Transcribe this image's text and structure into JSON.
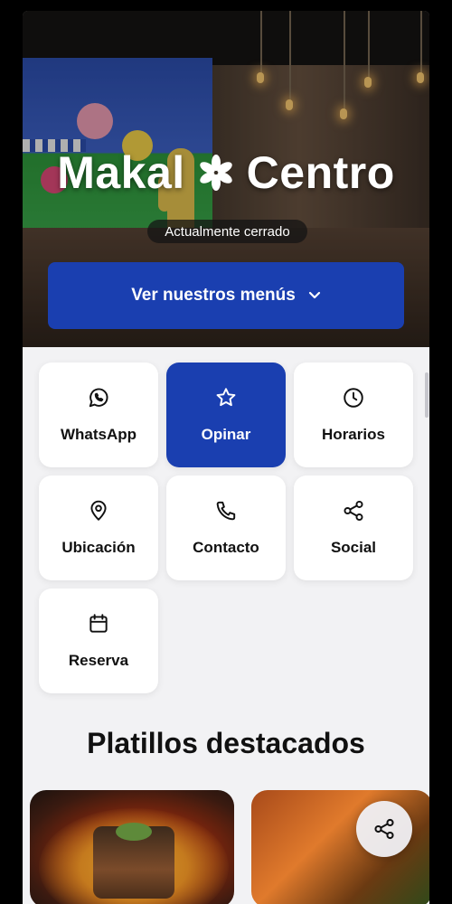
{
  "hero": {
    "venue_name_left": "Makal",
    "venue_name_right": "Centro",
    "status": "Actualmente cerrado",
    "menu_button_label": "Ver nuestros menús"
  },
  "actions": [
    {
      "label": "WhatsApp",
      "icon": "whatsapp-icon",
      "active": false
    },
    {
      "label": "Opinar",
      "icon": "star-icon",
      "active": true
    },
    {
      "label": "Horarios",
      "icon": "clock-icon",
      "active": false
    },
    {
      "label": "Ubicación",
      "icon": "location-pin-icon",
      "active": false
    },
    {
      "label": "Contacto",
      "icon": "phone-icon",
      "active": false
    },
    {
      "label": "Social",
      "icon": "share-icon",
      "active": false
    },
    {
      "label": "Reserva",
      "icon": "calendar-icon",
      "active": false
    }
  ],
  "featured": {
    "title": "Platillos destacados"
  },
  "colors": {
    "accent": "#1a3fb0",
    "background": "#f2f2f4",
    "card": "#ffffff"
  }
}
